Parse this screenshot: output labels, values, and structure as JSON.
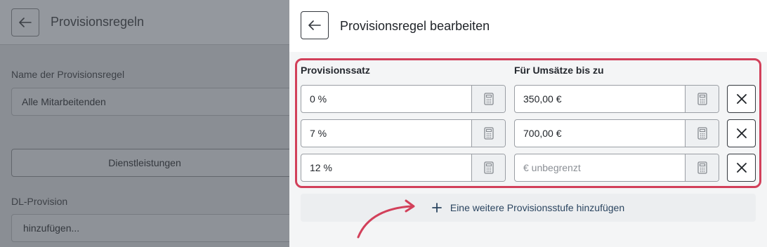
{
  "background": {
    "title": "Provisionsregeln",
    "rule_name_label": "Name der Provisionsregel",
    "rule_name_value": "Alle Mitarbeitenden",
    "services_button": "Dienstleistungen",
    "dl_label": "DL-Provision",
    "dl_placeholder": "hinzufügen..."
  },
  "panel": {
    "title": "Provisionsregel bearbeiten",
    "col_rate": "Provisionssatz",
    "col_limit": "Für Umsätze bis zu",
    "rows": [
      {
        "rate": "0 %",
        "limit": "350,00 €",
        "limit_placeholder": false
      },
      {
        "rate": "7 %",
        "limit": "700,00 €",
        "limit_placeholder": false
      },
      {
        "rate": "12 %",
        "limit": "€ unbegrenzt",
        "limit_placeholder": true
      }
    ],
    "add_label": "Eine weitere Provisionsstufe hinzufügen"
  },
  "colors": {
    "highlight": "#d2405a",
    "overlay": "#8a8e94"
  }
}
